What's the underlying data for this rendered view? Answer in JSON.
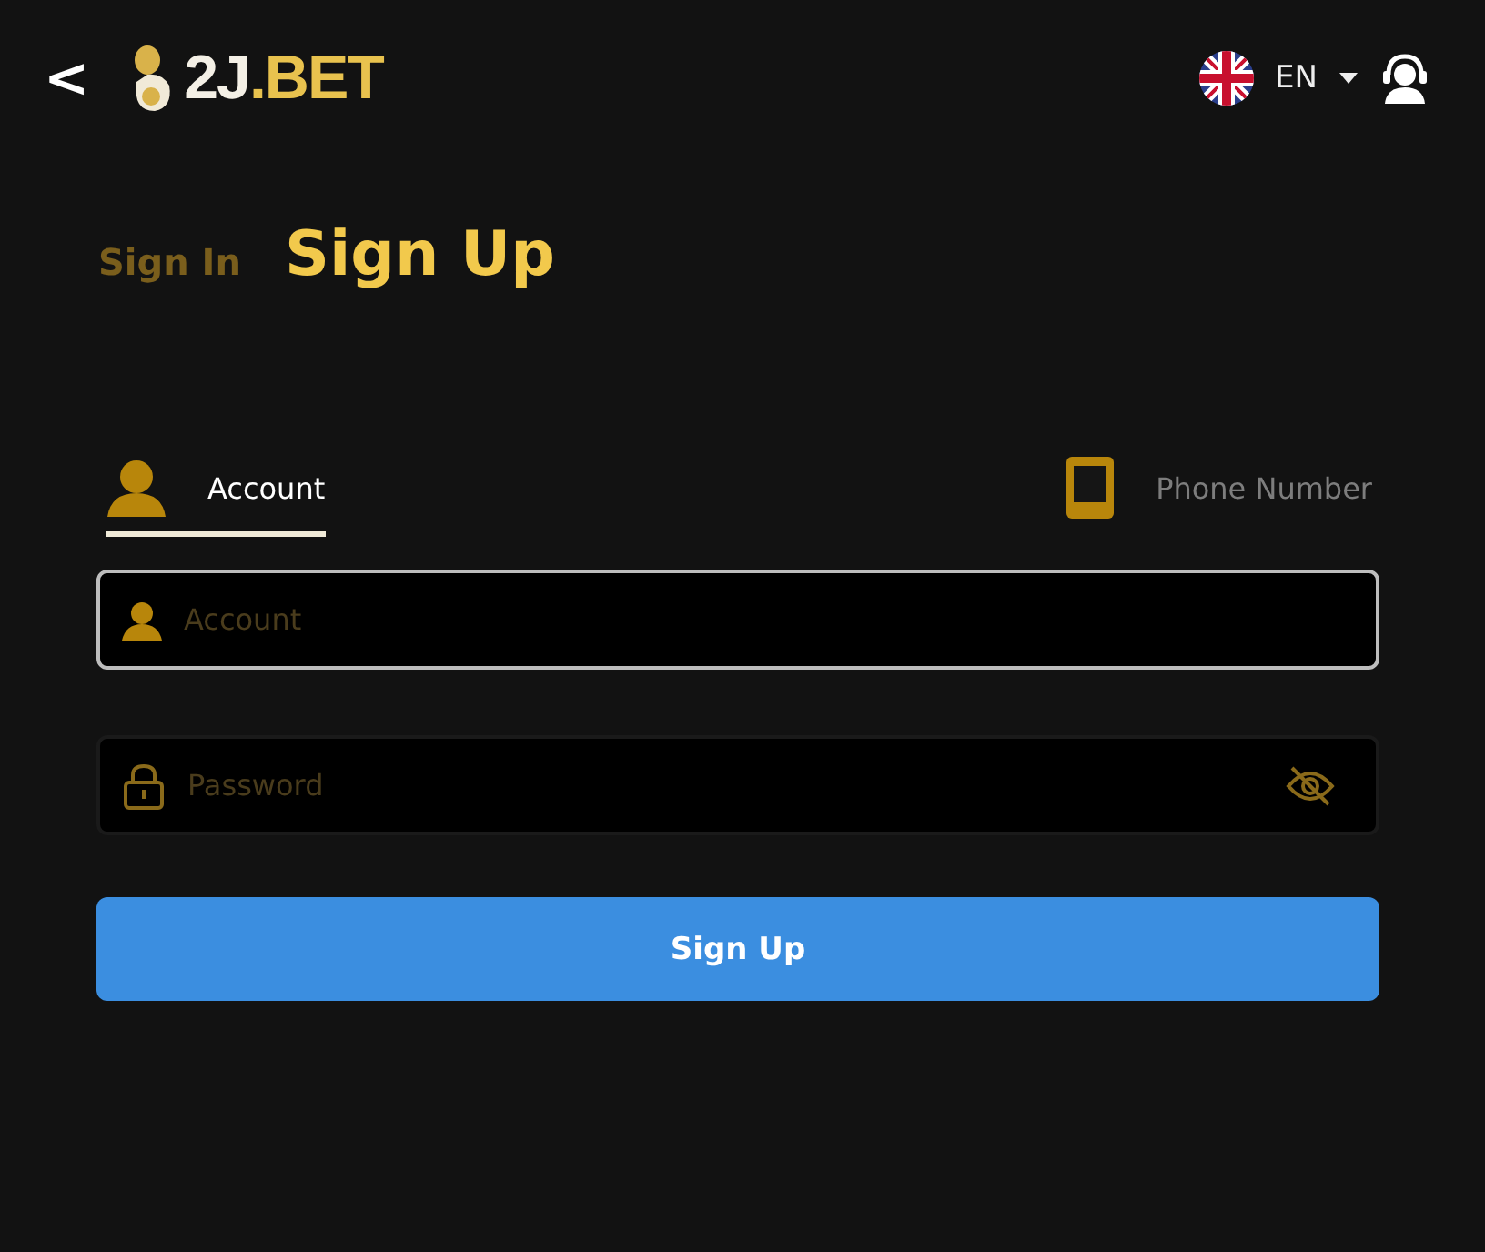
{
  "header": {
    "back": "<",
    "logo_main": "2J",
    "logo_accent": ".BET",
    "language": "EN"
  },
  "auth_tabs": [
    {
      "label": "Sign In",
      "selected": false
    },
    {
      "label": "Sign Up",
      "selected": true
    }
  ],
  "method_tabs": [
    {
      "label": "Account",
      "kind": "account",
      "selected": true
    },
    {
      "label": "Phone Number",
      "kind": "phone",
      "selected": false
    }
  ],
  "fields": [
    {
      "kind": "account",
      "placeholder": "Account",
      "focused": true
    },
    {
      "kind": "password",
      "placeholder": "Password",
      "focused": false
    }
  ],
  "submit": "Sign Up"
}
